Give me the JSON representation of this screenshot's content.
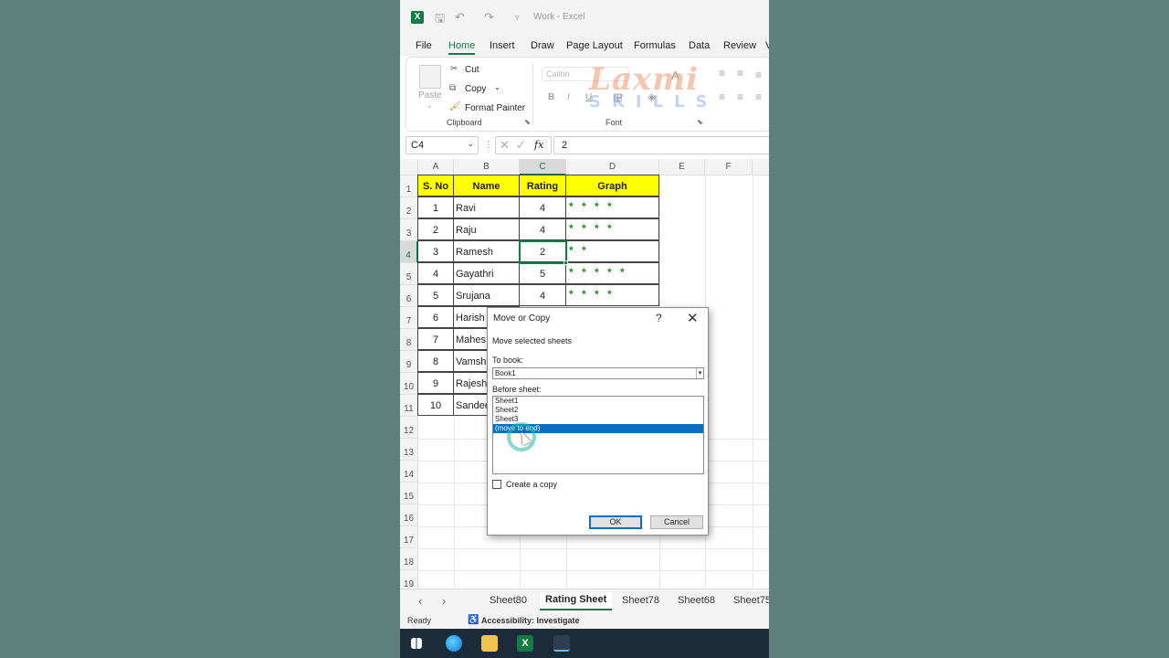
{
  "window": {
    "title": "Work  -  Excel",
    "app_icon": "X"
  },
  "quick_access": [
    "save-icon",
    "undo-icon",
    "redo-icon",
    "customize-icon"
  ],
  "ribbon_tabs": [
    "File",
    "Home",
    "Insert",
    "Draw",
    "Page Layout",
    "Formulas",
    "Data",
    "Review",
    "V"
  ],
  "ribbon": {
    "paste": "Paste",
    "cut": "Cut",
    "copy": "Copy",
    "format_painter": "Format Painter",
    "clipboard_label": "Clipboard",
    "font_name": "Calibri",
    "font_label": "Font",
    "bold": "B",
    "italic": "I",
    "underline": "U",
    "watermark_top": "Laxmi",
    "watermark_bottom": "SKILLS"
  },
  "formula_bar": {
    "name_box": "C4",
    "fx": "fx",
    "value": "2"
  },
  "columns": [
    "A",
    "B",
    "C",
    "D",
    "E",
    "F"
  ],
  "rows": [
    "1",
    "2",
    "3",
    "4",
    "5",
    "6",
    "7",
    "8",
    "9",
    "10",
    "11",
    "12",
    "13",
    "14",
    "15",
    "16",
    "17",
    "18",
    "19"
  ],
  "table": {
    "headers": [
      "S. No",
      "Name",
      "Rating",
      "Graph"
    ],
    "rows": [
      [
        "1",
        "Ravi",
        "4",
        "* * * *"
      ],
      [
        "2",
        "Raju",
        "4",
        "* * * *"
      ],
      [
        "3",
        "Ramesh",
        "2",
        "* *"
      ],
      [
        "4",
        "Gayathri",
        "5",
        "* * * * *"
      ],
      [
        "5",
        "Srujana",
        "4",
        "* * * *"
      ],
      [
        "6",
        "Harish",
        "",
        ""
      ],
      [
        "7",
        "Mahes",
        "",
        ""
      ],
      [
        "8",
        "Vamsh",
        "",
        ""
      ],
      [
        "9",
        "Rajesh",
        "",
        ""
      ],
      [
        "10",
        "Sandee",
        "",
        ""
      ]
    ]
  },
  "sheet_tabs": [
    "Sheet80",
    "Rating Sheet",
    "Sheet78",
    "Sheet68",
    "Sheet75"
  ],
  "active_sheet": "Rating Sheet",
  "status": {
    "ready": "Ready",
    "accessibility": "Accessibility: Investigate"
  },
  "dialog": {
    "title": "Move or Copy",
    "help": "?",
    "close": "✕",
    "move_selected": "Move selected sheets",
    "to_book_label": "To book:",
    "to_book_value": "Book1",
    "before_sheet_label": "Before sheet:",
    "sheets": [
      "Sheet1",
      "Sheet2",
      "Sheet3",
      "(move to end)"
    ],
    "selected_index": 3,
    "create_copy": "Create a copy",
    "ok": "OK",
    "cancel": "Cancel"
  },
  "colors": {
    "accent": "#107c41",
    "header_fill": "#ffff00",
    "star": "#1f8f1f",
    "selection": "#0a6fc2"
  }
}
